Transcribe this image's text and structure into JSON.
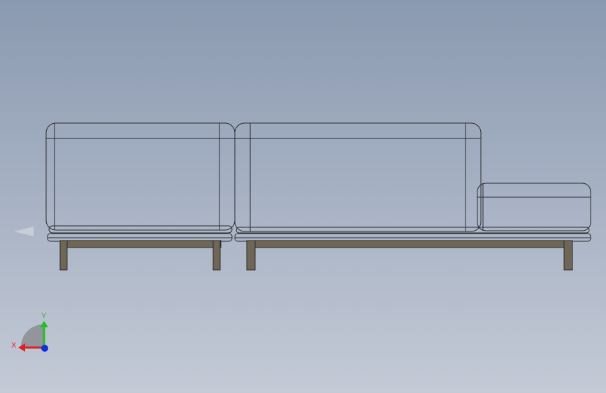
{
  "viewport": {
    "background_top": "#8a9ab0",
    "background_bottom": "#c4cad6"
  },
  "model": {
    "fabric_color": "#d9d7cc",
    "leg_color": "#6f6655",
    "edge_color": "#2b2b2b"
  },
  "triad": {
    "x_label": "X",
    "y_label": "Y",
    "x_color": "#e02020",
    "y_color": "#20c020",
    "z_color": "#1030e0"
  },
  "icons": {
    "view_arrow": "left-arrow-icon"
  }
}
